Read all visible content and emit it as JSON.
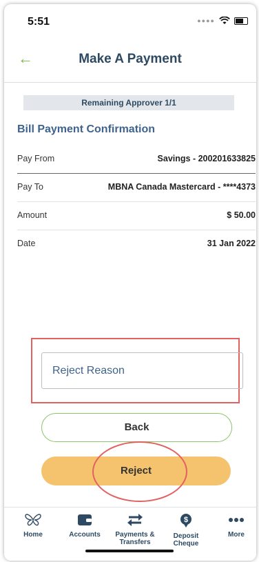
{
  "status_bar": {
    "time": "5:51"
  },
  "header": {
    "title": "Make A Payment"
  },
  "approver_banner": "Remaining Approver 1/1",
  "section_title": "Bill Payment Confirmation",
  "details": [
    {
      "label": "Pay From",
      "value": "Savings - 200201633825"
    },
    {
      "label": "Pay To",
      "value": "MBNA Canada Mastercard - ****4373"
    },
    {
      "label": "Amount",
      "value": "$ 50.00"
    },
    {
      "label": "Date",
      "value": "31 Jan 2022"
    }
  ],
  "reject_reason": {
    "placeholder": "Reject Reason",
    "value": ""
  },
  "buttons": {
    "back": "Back",
    "reject": "Reject"
  },
  "tabbar": [
    {
      "label": "Home",
      "icon": "butterfly-icon"
    },
    {
      "label": "Accounts",
      "icon": "wallet-icon"
    },
    {
      "label": "Payments & Transfers",
      "icon": "transfer-arrows-icon"
    },
    {
      "label": "Deposit Cheque",
      "icon": "dollar-pin-icon"
    },
    {
      "label": "More",
      "icon": "more-dots-icon"
    }
  ],
  "colors": {
    "accent_green": "#7bb845",
    "title_blue": "#2e4a63",
    "reject_button": "#f5c36e",
    "highlight_red": "#e26060"
  }
}
